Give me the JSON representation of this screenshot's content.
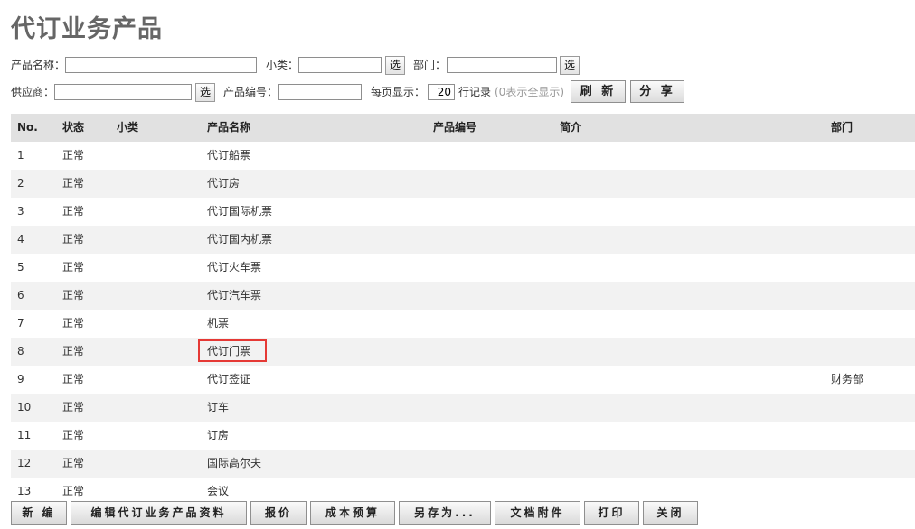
{
  "page": {
    "title": "代订业务产品"
  },
  "filters": {
    "product_name_label": "产品名称：",
    "product_name_value": "",
    "subcategory_label": "小类：",
    "subcategory_value": "",
    "department_label": "部门：",
    "department_value": "",
    "supplier_label": "供应商：",
    "supplier_value": "",
    "product_code_label": "产品编号：",
    "product_code_value": "",
    "per_page_label": "每页显示：",
    "per_page_value": "20",
    "rows_unit": "行记录",
    "rows_hint": "(0表示全显示)",
    "select_label": "选",
    "refresh_label": "刷 新",
    "share_label": "分 享"
  },
  "table": {
    "columns": [
      "No.",
      "状态",
      "小类",
      "产品名称",
      "产品编号",
      "简介",
      "部门"
    ],
    "rows": [
      {
        "no": "1",
        "status": "正常",
        "subcategory": "",
        "name": "代订船票",
        "code": "",
        "intro": "",
        "dept": ""
      },
      {
        "no": "2",
        "status": "正常",
        "subcategory": "",
        "name": "代订房",
        "code": "",
        "intro": "",
        "dept": ""
      },
      {
        "no": "3",
        "status": "正常",
        "subcategory": "",
        "name": "代订国际机票",
        "code": "",
        "intro": "",
        "dept": ""
      },
      {
        "no": "4",
        "status": "正常",
        "subcategory": "",
        "name": "代订国内机票",
        "code": "",
        "intro": "",
        "dept": ""
      },
      {
        "no": "5",
        "status": "正常",
        "subcategory": "",
        "name": "代订火车票",
        "code": "",
        "intro": "",
        "dept": ""
      },
      {
        "no": "6",
        "status": "正常",
        "subcategory": "",
        "name": "代订汽车票",
        "code": "",
        "intro": "",
        "dept": ""
      },
      {
        "no": "7",
        "status": "正常",
        "subcategory": "",
        "name": "机票",
        "code": "",
        "intro": "",
        "dept": ""
      },
      {
        "no": "8",
        "status": "正常",
        "subcategory": "",
        "name": "代订门票",
        "code": "",
        "intro": "",
        "dept": ""
      },
      {
        "no": "9",
        "status": "正常",
        "subcategory": "",
        "name": "代订签证",
        "code": "",
        "intro": "",
        "dept": "财务部"
      },
      {
        "no": "10",
        "status": "正常",
        "subcategory": "",
        "name": "订车",
        "code": "",
        "intro": "",
        "dept": ""
      },
      {
        "no": "11",
        "status": "正常",
        "subcategory": "",
        "name": "订房",
        "code": "",
        "intro": "",
        "dept": ""
      },
      {
        "no": "12",
        "status": "正常",
        "subcategory": "",
        "name": "国际高尔夫",
        "code": "",
        "intro": "",
        "dept": ""
      },
      {
        "no": "13",
        "status": "正常",
        "subcategory": "",
        "name": "会议",
        "code": "",
        "intro": "",
        "dept": ""
      }
    ]
  },
  "toolbar": {
    "new_label": "新 编",
    "edit_label": "编辑代订业务产品资料",
    "quote_label": "报价",
    "cost_budget_label": "成本预算",
    "save_as_label": "另存为...",
    "attachments_label": "文档附件",
    "print_label": "打印",
    "close_label": "关闭"
  }
}
